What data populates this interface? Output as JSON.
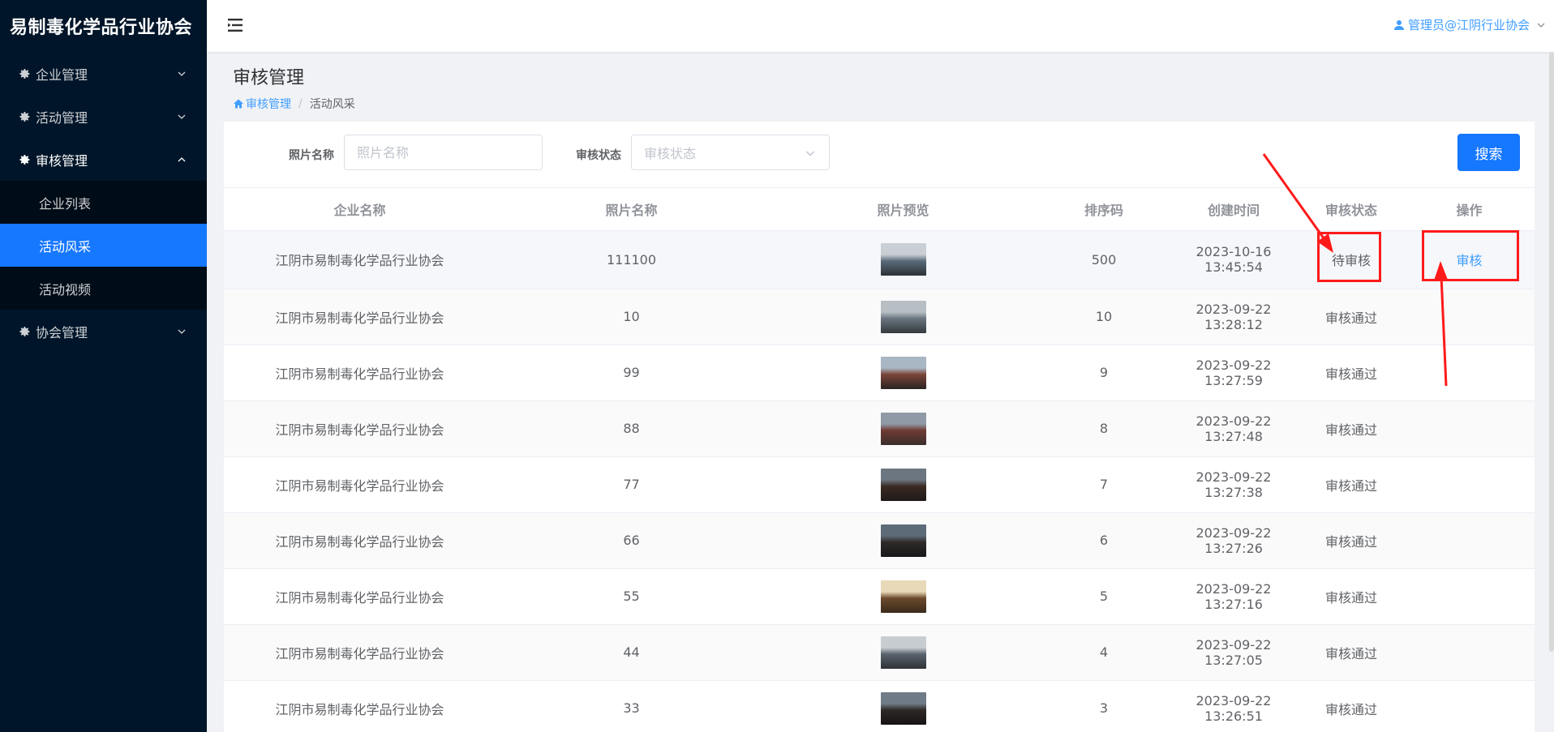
{
  "brand": {
    "title": "易制毒化学品行业协会"
  },
  "sidebar": {
    "items": [
      {
        "label": "企业管理",
        "open": false
      },
      {
        "label": "活动管理",
        "open": false
      },
      {
        "label": "审核管理",
        "open": true,
        "children": [
          {
            "label": "企业列表",
            "active": false
          },
          {
            "label": "活动风采",
            "active": true
          },
          {
            "label": "活动视频",
            "active": false
          }
        ]
      },
      {
        "label": "协会管理",
        "open": false
      }
    ]
  },
  "header": {
    "user": "管理员@江阴行业协会"
  },
  "page": {
    "title": "审核管理"
  },
  "breadcrumb": {
    "home": "审核管理",
    "current": "活动风采"
  },
  "filters": {
    "photo_name_label": "照片名称",
    "photo_name_placeholder": "照片名称",
    "status_label": "审核状态",
    "status_placeholder": "审核状态",
    "search_label": "搜索"
  },
  "table": {
    "headers": [
      "企业名称",
      "照片名称",
      "照片预览",
      "排序码",
      "创建时间",
      "审核状态",
      "操作"
    ],
    "rows": [
      {
        "company": "江阴市易制毒化学品行业协会",
        "photo": "111100",
        "sort": "500",
        "created": "2023-10-16 13:45:54",
        "status": "待审核",
        "action": "审核",
        "thumb": [
          "#5a6b7a",
          "#c9cfd4",
          "#2c3136"
        ]
      },
      {
        "company": "江阴市易制毒化学品行业协会",
        "photo": "10",
        "sort": "10",
        "created": "2023-09-22 13:28:12",
        "status": "审核通过",
        "action": "",
        "thumb": [
          "#6a7580",
          "#b7bec4",
          "#34393e"
        ]
      },
      {
        "company": "江阴市易制毒化学品行业协会",
        "photo": "99",
        "sort": "9",
        "created": "2023-09-22 13:27:59",
        "status": "审核通过",
        "action": "",
        "thumb": [
          "#7a4438",
          "#a9b6c3",
          "#2b2424"
        ]
      },
      {
        "company": "江阴市易制毒化学品行业协会",
        "photo": "88",
        "sort": "8",
        "created": "2023-09-22 13:27:48",
        "status": "审核通过",
        "action": "",
        "thumb": [
          "#6e3a32",
          "#8f9aa6",
          "#3a2e2c"
        ]
      },
      {
        "company": "江阴市易制毒化学品行业协会",
        "photo": "77",
        "sort": "7",
        "created": "2023-09-22 13:27:38",
        "status": "审核通过",
        "action": "",
        "thumb": [
          "#3a2a22",
          "#6c7680",
          "#1f1a18"
        ]
      },
      {
        "company": "江阴市易制毒化学品行业协会",
        "photo": "66",
        "sort": "6",
        "created": "2023-09-22 13:27:26",
        "status": "审核通过",
        "action": "",
        "thumb": [
          "#2f2a28",
          "#5d6b78",
          "#17161a"
        ]
      },
      {
        "company": "江阴市易制毒化学品行业协会",
        "photo": "55",
        "sort": "5",
        "created": "2023-09-22 13:27:16",
        "status": "审核通过",
        "action": "",
        "thumb": [
          "#6b4a2c",
          "#e8d9b8",
          "#3a2a1c"
        ]
      },
      {
        "company": "江阴市易制毒化学品行业协会",
        "photo": "44",
        "sort": "4",
        "created": "2023-09-22 13:27:05",
        "status": "审核通过",
        "action": "",
        "thumb": [
          "#59636d",
          "#c8cdd1",
          "#2e3236"
        ]
      },
      {
        "company": "江阴市易制毒化学品行业协会",
        "photo": "33",
        "sort": "3",
        "created": "2023-09-22 13:26:51",
        "status": "审核通过",
        "action": "",
        "thumb": [
          "#2e2826",
          "#6f7b86",
          "#161414"
        ]
      }
    ]
  },
  "colors": {
    "accent": "#1677ff",
    "link": "#409eff",
    "sidebar_bg": "#001529",
    "annotation": "#ff1a1a"
  }
}
